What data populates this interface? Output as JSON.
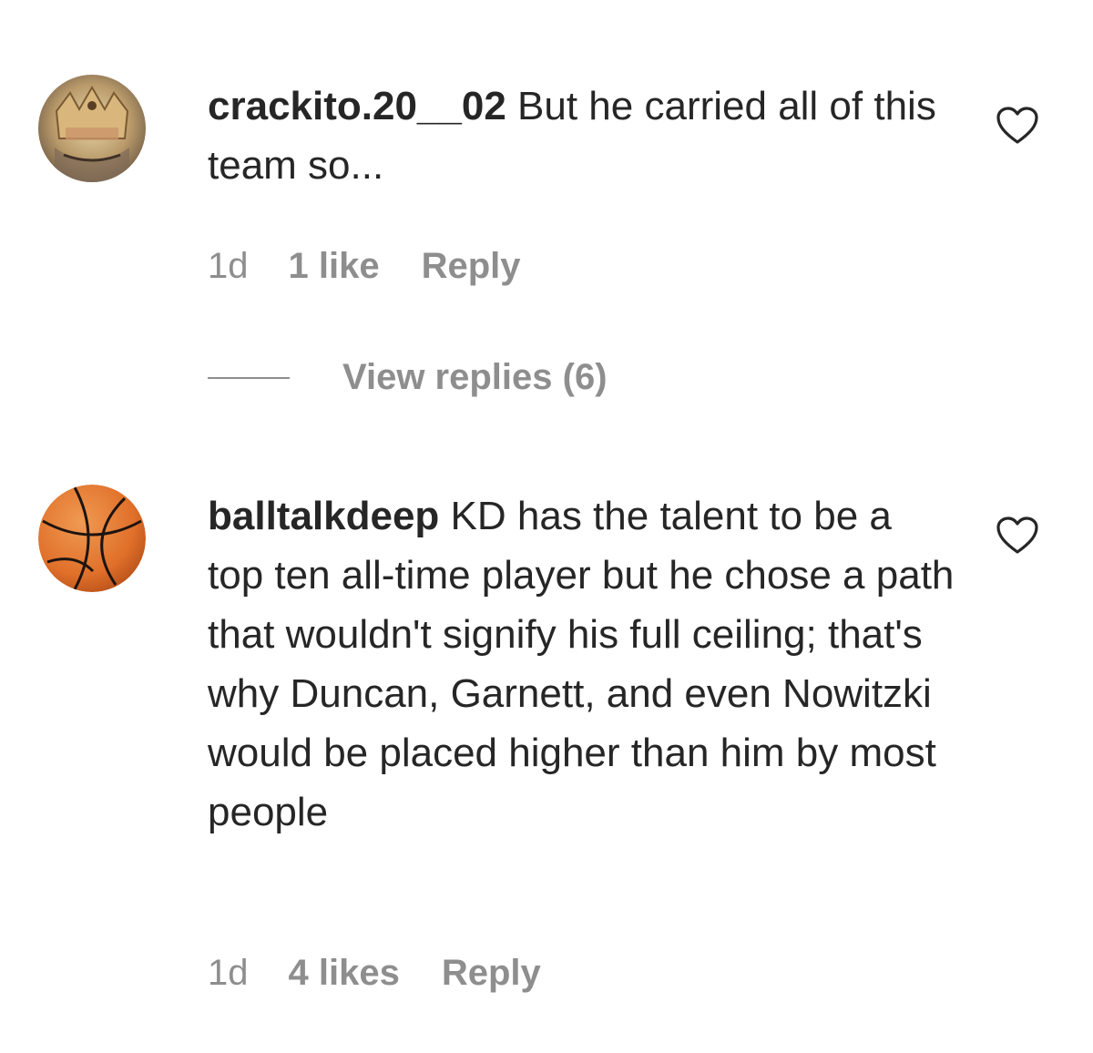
{
  "comments": [
    {
      "username": "crackito.20__02",
      "text": " But he carried all of this team so...",
      "time": "1d",
      "likes": "1 like",
      "reply": "Reply",
      "avatar_icon": "king-avatar-icon",
      "view_replies": "View replies (6)"
    },
    {
      "username": "balltalkdeep",
      "text": " KD has the talent to be a top ten all-time player but he chose a path that wouldn't signify his full ceiling; that's why Duncan, Garnett, and even Nowitzki would be placed higher than him by most people",
      "time": "1d",
      "likes": "4 likes",
      "reply": "Reply",
      "avatar_icon": "basketball-avatar-icon"
    }
  ],
  "colors": {
    "text": "#262626",
    "secondary": "#8e8e8e",
    "background": "#ffffff",
    "basketball": "#e0702a"
  }
}
